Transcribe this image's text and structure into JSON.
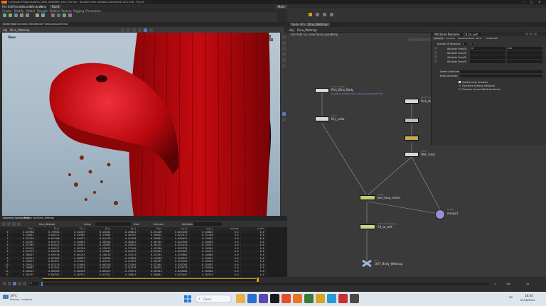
{
  "window": {
    "title": "D:/Houdini/Projects/DINO_HAIR_SIM/DINO_Hair_V02.hip - Houdini Indie Limited-Commercial 20.0.506 - Py3.10"
  },
  "menu": [
    "File",
    "Edit",
    "Render",
    "Assets",
    "Windows",
    "Help"
  ],
  "workspace": {
    "desktop": "Build",
    "main_label": "Main"
  },
  "shelf": {
    "tabs": [
      "Create",
      "Modify",
      "Model",
      "Polygon",
      "Deform",
      "Texture",
      "Rigging",
      "Characters"
    ]
  },
  "viewport": {
    "tabs": [
      "Scene View",
      "Animation Editor",
      "Render View",
      "Composite View"
    ],
    "label": "View",
    "persp": "Persp",
    "camera": "No cam",
    "path": "obj",
    "object": "Dino_Wetmap"
  },
  "spreadsheet": {
    "tabs": [
      "Geometry Spreadsheet",
      "Python Shell",
      "Dino_Wetmap"
    ],
    "node": "Dino_Wetmap",
    "group": "Group",
    "view": "View",
    "intrinsics": "Intrinsics",
    "attributes": "Attributes",
    "columns": [
      "",
      "P[x]",
      "P[y]",
      "P[z]",
      "N[x]",
      "N[y]",
      "N[z]",
      "uv[x]",
      "uv[y]",
      "wetmap",
      "width"
    ],
    "rows": [
      [
        "0",
        "0.319988",
        "0.795954",
        "0.442675",
        "0.434541",
        "-0.290614",
        "0.351209",
        "0.0253455",
        "0.128843",
        "0.0",
        "0.0"
      ],
      [
        "1",
        "0.318822",
        "0.802211",
        "0.445982",
        "0.376602",
        "-0.301447",
        "0.356631",
        "0.0254127",
        "0.131206",
        "0.0",
        "0.0"
      ],
      [
        "2",
        "0.321103",
        "0.811458",
        "0.442571",
        "0.341293",
        "-0.331958",
        "0.399813",
        "0.0256471",
        "0.134552",
        "0.0",
        "0.0"
      ],
      [
        "3",
        "0.322451",
        "0.815773",
        "0.444816",
        "0.301944",
        "-0.302813",
        "0.387201",
        "0.0257603",
        "0.136628",
        "0.0",
        "0.0"
      ],
      [
        "4",
        "0.317654",
        "0.825412",
        "0.449521",
        "0.263987",
        "-0.286513",
        "0.401337",
        "0.0255214",
        "0.139347",
        "0.0",
        "0.0"
      ],
      [
        "5",
        "0.315476",
        "0.834571",
        "0.452318",
        "0.230112",
        "-0.275496",
        "0.412558",
        "0.0253761",
        "0.142061",
        "0.0",
        "0.0"
      ],
      [
        "6",
        "0.312579",
        "0.841258",
        "0.456971",
        "0.194025",
        "-0.264472",
        "0.425916",
        "0.0251837",
        "0.145124",
        "0.0",
        "0.0"
      ],
      [
        "7",
        "0.308457",
        "0.849746",
        "0.461255",
        "0.160133",
        "-0.252119",
        "0.437452",
        "0.0249062",
        "0.148005",
        "0.0",
        "0.0"
      ],
      [
        "8",
        "0.304119",
        "0.857842",
        "0.465873",
        "0.126954",
        "-0.243556",
        "0.449183",
        "0.0246517",
        "0.150813",
        "0.0",
        "0.0"
      ],
      [
        "9",
        "0.299874",
        "0.864471",
        "0.470112",
        "0.094712",
        "-0.231874",
        "0.461207",
        "0.0243935",
        "0.153294",
        "0.0",
        "0.0"
      ],
      [
        "10",
        "0.295412",
        "0.871125",
        "0.474655",
        "0.062318",
        "-0.221045",
        "0.472461",
        "0.0241381",
        "0.155837",
        "0.0",
        "0.0"
      ],
      [
        "11",
        "0.290867",
        "0.877014",
        "0.479118",
        "0.031257",
        "-0.210138",
        "0.484075",
        "0.0238719",
        "0.158104",
        "0.0",
        "0.0"
      ],
      [
        "12",
        "0.286124",
        "0.882569",
        "0.483346",
        "0.001874",
        "-0.199372",
        "0.495613",
        "0.0236062",
        "0.160382",
        "0.0",
        "0.0"
      ],
      [
        "13",
        "0.281397",
        "0.887932",
        "0.487911",
        "-0.027521",
        "-0.188615",
        "0.506842",
        "0.0233421",
        "0.162519",
        "0.0",
        "0.0"
      ]
    ]
  },
  "network": {
    "tabs": [
      "Node Info",
      "Dino_Wetmap"
    ],
    "path": "obj",
    "object": "Dino_Wetmap",
    "menu": [
      "Add",
      "Edit",
      "Go",
      "View",
      "Tools",
      "Layout",
      "Help"
    ],
    "context_label": "Geometry",
    "nodes": [
      {
        "name": "Pick_Dino_Body",
        "sub": "Object Merge",
        "extra": "/obj/Dino_Hair/OUT_Dino_Body_Wetmap/OUT_Bo"
      },
      {
        "name": "Dry_color",
        "sub": "Color"
      },
      {
        "name": "Pick_Hair",
        "sub": "Object Merge"
      },
      {
        "name": "Wet_Color",
        "sub": "Color"
      },
      {
        "name": "wet_map_solver",
        "sub": "Solver"
      },
      {
        "name": "merge1",
        "sub": "Merge"
      },
      {
        "name": "Cd_to_wet",
        "sub": "Attribute Wrangle"
      },
      {
        "name": "OUT_Body_Wetmap",
        "sub": "Null"
      }
    ]
  },
  "parm_panel": {
    "title": "Attribute Rename",
    "node": "Cd_to_wet",
    "tabs": [
      "Rename",
      "Promote",
      "Rename/Delete",
      "Attrib",
      "Delete Attr"
    ],
    "rows_label": "Number of Renames",
    "rows_count": "4",
    "entries": [
      {
        "label": "Attribute From/To",
        "from": "Cd",
        "to": "wet"
      },
      {
        "label": "Attribute From/To",
        "from": "",
        "to": ""
      },
      {
        "label": "Attribute From/To",
        "from": "",
        "to": ""
      },
      {
        "label": "Attribute From/To",
        "from": "",
        "to": ""
      }
    ],
    "delete_label": "Delete Attributes",
    "keep_label": "Keep Attributes",
    "checks": [
      "Update Local Variables",
      "Overwrite Existing Attributes",
      "Preserve Unused Attribute Names"
    ]
  },
  "timeline": {
    "frame": "1",
    "start": "1",
    "end": "240",
    "fps": "24"
  },
  "taskbar": {
    "weather": "19°C",
    "weather_desc": "Piovoso, nuvoloso",
    "search_placeholder": "Cerca",
    "time": "18:34",
    "date": "05/06/2024",
    "lang": "ITA"
  },
  "colors": {
    "accent": "#d4a017",
    "node_selected": "#b5d26a",
    "merge": "#9b8ed4",
    "blood": "#b0080c"
  }
}
